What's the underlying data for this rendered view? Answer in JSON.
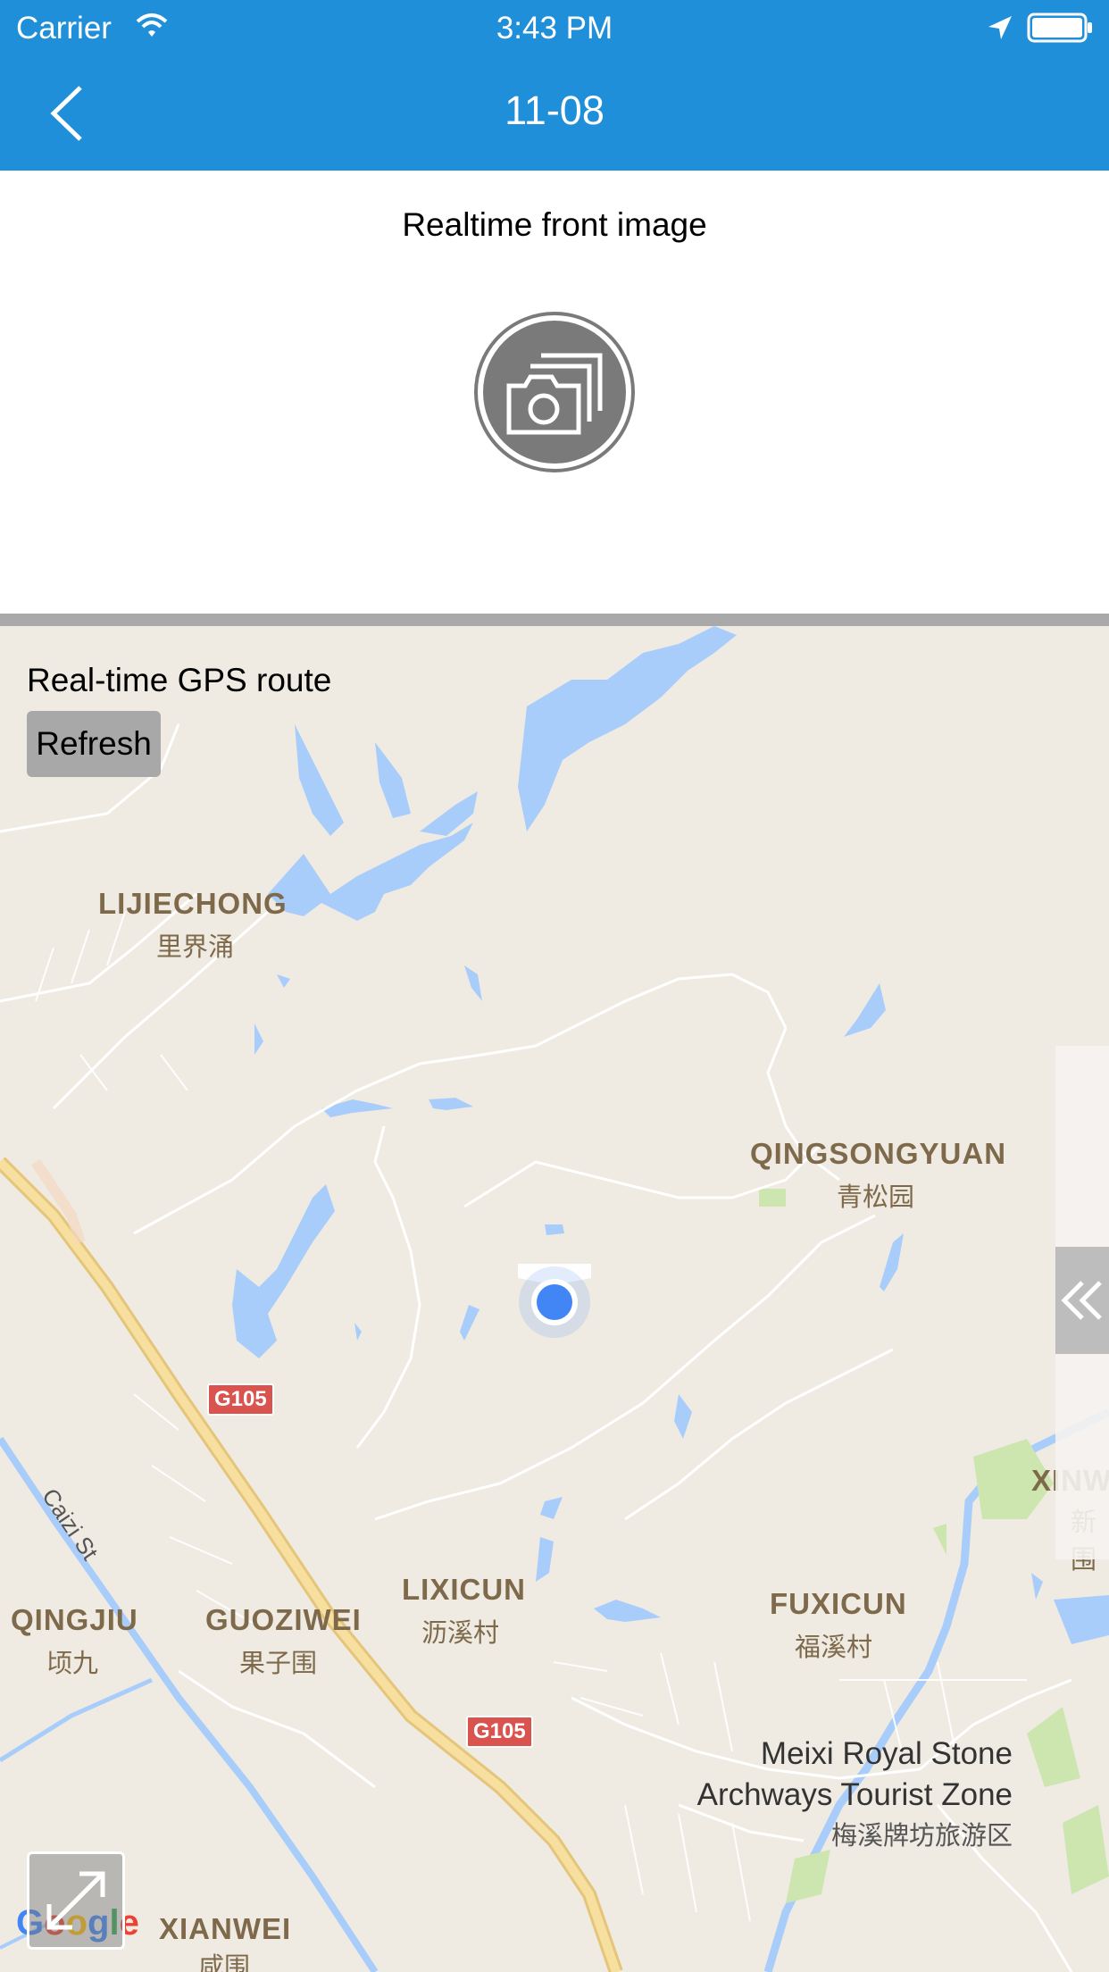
{
  "status_bar": {
    "carrier": "Carrier",
    "time": "3:43 PM"
  },
  "nav": {
    "title": "11-08"
  },
  "image_section": {
    "title": "Realtime front image"
  },
  "gps_section": {
    "title": "Real-time GPS route",
    "refresh_label": "Refresh"
  },
  "map": {
    "labels": {
      "lijiechong": "LIJIECHONG",
      "lijiechong_cn": "里界涌",
      "qingsongyuan": "QINGSONGYUAN",
      "qingsongyuan_cn": "青松园",
      "lixicun": "LIXICUN",
      "lixicun_cn": "沥溪村",
      "qingjiu": "QINGJIU",
      "qingjiu_cn": "顷九",
      "guoziwei": "GUOZIWEI",
      "guoziwei_cn": "果子围",
      "fuxicun": "FUXICUN",
      "fuxicun_cn": "福溪村",
      "xianwei": "XIANWEI",
      "xianwei_cn": "咸围",
      "xinw": "XINW",
      "xinw_cn": "新围"
    },
    "poi": {
      "line1": "Meixi Royal Stone",
      "line2": "Archways Tourist Zone",
      "line3": "梅溪牌坊旅游区"
    },
    "road_shield_1": "G105",
    "road_shield_2": "G105",
    "street": "Caizi St",
    "logo": "Google",
    "colors": {
      "land": "#efebe3",
      "water": "#a9cdfb",
      "highway": "#f4d88e",
      "park": "#cde6b0",
      "location_dot": "#4285f4"
    }
  },
  "colors": {
    "header": "#1f8fd9",
    "divider": "#a9a9a9",
    "refresh_bg": "#a8a8a8"
  }
}
